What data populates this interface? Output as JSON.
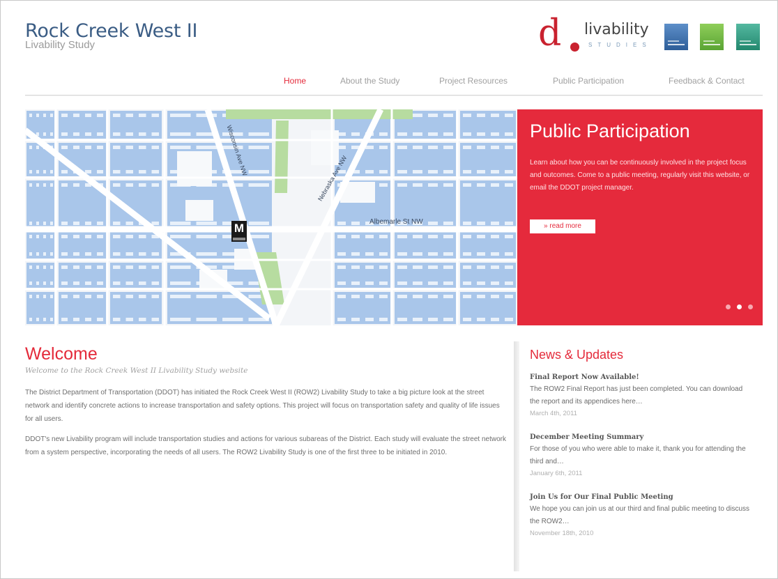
{
  "header": {
    "site_title": "Rock Creek West II",
    "site_subtitle": "Livability Study",
    "brand": {
      "letter": "d",
      "word": "livability",
      "tagline": "STUDIES"
    }
  },
  "nav": {
    "items": [
      {
        "label": "Home",
        "active": true
      },
      {
        "label": "About the Study",
        "active": false
      },
      {
        "label": "Project Resources",
        "active": false
      },
      {
        "label": "Public Participation",
        "active": false
      },
      {
        "label": "Feedback & Contact",
        "active": false
      }
    ]
  },
  "hero": {
    "map_labels": {
      "street_1": "Wisconsin Ave NW",
      "street_2": "Nebraska Ave NW",
      "street_3": "Albemarle St NW",
      "metro": "M"
    },
    "panel": {
      "heading": "Public Participation",
      "body": "Learn about how you can be continuously involved in the project focus and outcomes. Come to a public meeting, regularly visit this website, or email the DDOT project manager.",
      "read_more": "» read more",
      "slide_count": 3,
      "active_slide": 2
    }
  },
  "welcome": {
    "heading": "Welcome",
    "subheading": "Welcome to the Rock Creek West II Livability Study website",
    "paragraph_1": "The District Department of Transportation (DDOT) has initiated the Rock Creek West II (ROW2) Livability Study to take a big picture look at the street network and identify concrete actions to increase transportation and safety options. This project will focus on transportation safety and quality of life issues for all users.",
    "paragraph_2": "DDOT's new Livability program will include transportation studies and actions for various subareas of the District. Each study will evaluate the street network from a system perspective, incorporating the needs of all users. The ROW2 Livability Study is one of the first three to be initiated in 2010."
  },
  "news": {
    "heading": "News & Updates",
    "items": [
      {
        "title": "Final Report Now Available!",
        "body": "The ROW2 Final Report has just been completed. You can download the report and its appendices here…",
        "date": "March 4th, 2011"
      },
      {
        "title": "December Meeting Summary",
        "body": "For those of you who were able to make it, thank you for attending the third and…",
        "date": "January 6th, 2011"
      },
      {
        "title": "Join Us for Our Final Public Meeting",
        "body": "We hope you can join us at our third and final public meeting to discuss the ROW2…",
        "date": "November 18th, 2010"
      }
    ]
  },
  "colors": {
    "accent_red": "#e42a3a",
    "title_blue": "#3a5c84",
    "map_block": "#a9c6ea",
    "park_green": "#b7dca0"
  }
}
